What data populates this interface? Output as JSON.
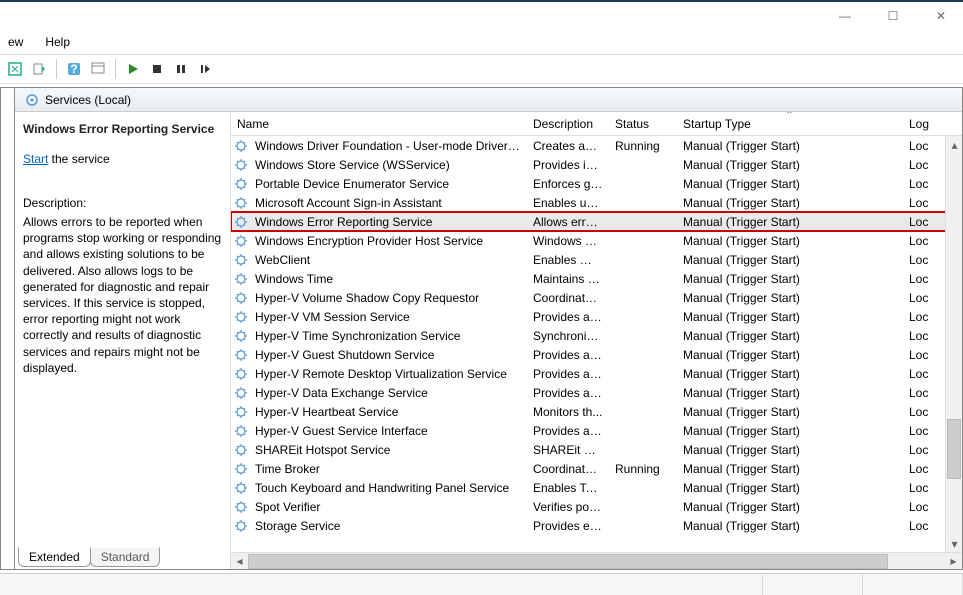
{
  "window": {
    "min": "—",
    "max": "☐",
    "close": "✕"
  },
  "menu": {
    "view": "ew",
    "help": "Help"
  },
  "tree": {
    "label": "Services (Local)"
  },
  "detail": {
    "title": "Windows Error Reporting Service",
    "start_link": "Start",
    "start_suffix": " the service",
    "desc_label": "Description:",
    "desc": "Allows errors to be reported when programs stop working or responding and allows existing solutions to be delivered. Also allows logs to be generated for diagnostic and repair services. If this service is stopped, error reporting might not work correctly and results of diagnostic services and repairs might not be displayed."
  },
  "columns": {
    "name": "Name",
    "desc": "Description",
    "status": "Status",
    "startup": "Startup Type",
    "logon": "Log"
  },
  "services": [
    {
      "name": "Windows Driver Foundation - User-mode Driver Fr...",
      "desc": "Creates and...",
      "status": "Running",
      "startup": "Manual (Trigger Start)",
      "logon": "Loc"
    },
    {
      "name": "Windows Store Service (WSService)",
      "desc": "Provides inf...",
      "status": "",
      "startup": "Manual (Trigger Start)",
      "logon": "Loc"
    },
    {
      "name": "Portable Device Enumerator Service",
      "desc": "Enforces gr...",
      "status": "",
      "startup": "Manual (Trigger Start)",
      "logon": "Loc"
    },
    {
      "name": "Microsoft Account Sign-in Assistant",
      "desc": "Enables use...",
      "status": "",
      "startup": "Manual (Trigger Start)",
      "logon": "Loc"
    },
    {
      "name": "Windows Error Reporting Service",
      "desc": "Allows error...",
      "status": "",
      "startup": "Manual (Trigger Start)",
      "logon": "Loc",
      "highlighted": true,
      "selected": true
    },
    {
      "name": "Windows Encryption Provider Host Service",
      "desc": "Windows E...",
      "status": "",
      "startup": "Manual (Trigger Start)",
      "logon": "Loc"
    },
    {
      "name": "WebClient",
      "desc": "Enables Win...",
      "status": "",
      "startup": "Manual (Trigger Start)",
      "logon": "Loc"
    },
    {
      "name": "Windows Time",
      "desc": "Maintains d...",
      "status": "",
      "startup": "Manual (Trigger Start)",
      "logon": "Loc"
    },
    {
      "name": "Hyper-V Volume Shadow Copy Requestor",
      "desc": "Coordinates...",
      "status": "",
      "startup": "Manual (Trigger Start)",
      "logon": "Loc"
    },
    {
      "name": "Hyper-V VM Session Service",
      "desc": "Provides a ...",
      "status": "",
      "startup": "Manual (Trigger Start)",
      "logon": "Loc"
    },
    {
      "name": "Hyper-V Time Synchronization Service",
      "desc": "Synchronize...",
      "status": "",
      "startup": "Manual (Trigger Start)",
      "logon": "Loc"
    },
    {
      "name": "Hyper-V Guest Shutdown Service",
      "desc": "Provides a ...",
      "status": "",
      "startup": "Manual (Trigger Start)",
      "logon": "Loc"
    },
    {
      "name": "Hyper-V Remote Desktop Virtualization Service",
      "desc": "Provides a p...",
      "status": "",
      "startup": "Manual (Trigger Start)",
      "logon": "Loc"
    },
    {
      "name": "Hyper-V Data Exchange Service",
      "desc": "Provides a ...",
      "status": "",
      "startup": "Manual (Trigger Start)",
      "logon": "Loc"
    },
    {
      "name": "Hyper-V Heartbeat Service",
      "desc": "Monitors th...",
      "status": "",
      "startup": "Manual (Trigger Start)",
      "logon": "Loc"
    },
    {
      "name": "Hyper-V Guest Service Interface",
      "desc": "Provides an ...",
      "status": "",
      "startup": "Manual (Trigger Start)",
      "logon": "Loc"
    },
    {
      "name": "SHAREit Hotspot Service",
      "desc": "SHAREit Ho...",
      "status": "",
      "startup": "Manual (Trigger Start)",
      "logon": "Loc"
    },
    {
      "name": "Time Broker",
      "desc": "Coordinates...",
      "status": "Running",
      "startup": "Manual (Trigger Start)",
      "logon": "Loc"
    },
    {
      "name": "Touch Keyboard and Handwriting Panel Service",
      "desc": "Enables Tou...",
      "status": "",
      "startup": "Manual (Trigger Start)",
      "logon": "Loc"
    },
    {
      "name": "Spot Verifier",
      "desc": "Verifies pote...",
      "status": "",
      "startup": "Manual (Trigger Start)",
      "logon": "Loc"
    },
    {
      "name": "Storage Service",
      "desc": "Provides en...",
      "status": "",
      "startup": "Manual (Trigger Start)",
      "logon": "Loc"
    }
  ],
  "tabs": {
    "extended": "Extended",
    "standard": "Standard"
  }
}
